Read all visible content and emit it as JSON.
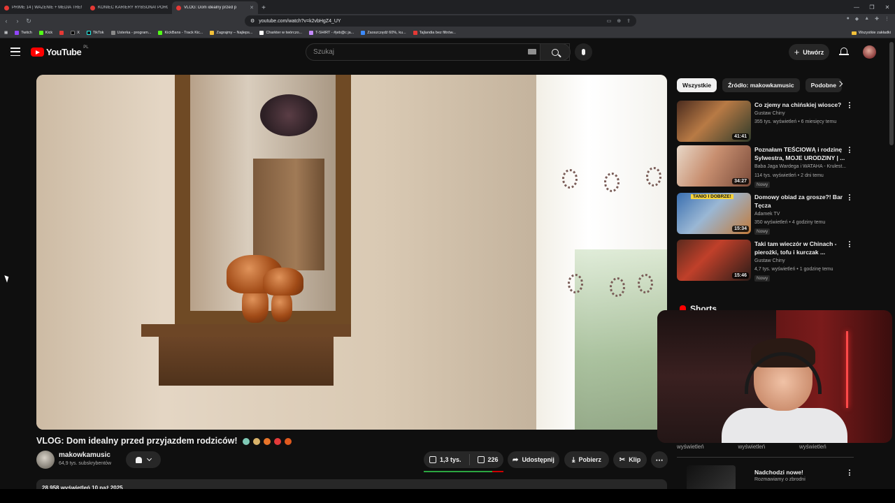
{
  "browser": {
    "tabs": [
      {
        "title": "PRIME 14 | WAŻENIE + MEDIA TRENI",
        "active": false
      },
      {
        "title": "KONIEC KARIERY RYBSONA! PORÓŻ",
        "active": false
      },
      {
        "title": "VLOG: Dom idealny przed p",
        "active": true
      }
    ],
    "url": "youtube.com/watch?v=k2vbHgZ4_UY",
    "bookmarks": [
      "Twitch",
      "Kick",
      "X",
      "TikTok",
      "Usterka - program...",
      "KickBans - Track Kic...",
      "Zagrajmy – Najleps...",
      "Charkter w twórczo...",
      "T-SHIRT - #jeb@c ja...",
      "Zaoszczędź 60%, ku...",
      "Tajlandia bez filtrów..."
    ],
    "bookmarks_folder": "Wszystkie zakładki"
  },
  "yt_header": {
    "logo_text": "YouTube",
    "country": "PL",
    "search_placeholder": "Szukaj",
    "create_label": "Utwórz"
  },
  "video": {
    "title": "VLOG: Dom idealny przed przyjazdem rodziców!",
    "channel": "makowkamusic",
    "subscribers": "64,9 tys. subskrybentów",
    "likes": "1,3 tys.",
    "dislikes": "226",
    "share_label": "Udostępnij",
    "download_label": "Pobierz",
    "clip_label": "Klip",
    "like_ratio": 0.86,
    "description_header": "28 958 wyświetleń  10 paź 2025"
  },
  "sidebar": {
    "chips": [
      "Wszystkie",
      "Źródło: makowkamusic",
      "Podobne"
    ],
    "recommendations": [
      {
        "title": "Co zjemy na chińskiej wiosce?",
        "channel": "Gustaw Chiny",
        "meta": "355 tys. wyświetleń • 6 miesięcy temu",
        "duration": "41:41",
        "badge": ""
      },
      {
        "title": "Poznałam TEŚCIOWĄ i rodzinę Sylwestra, MOJE URODZINY | ...",
        "channel": "Baba Jaga Wardega i WATAHA - Krulest...",
        "meta": "114 tys. wyświetleń • 2 dni temu",
        "duration": "34:27",
        "badge": "Nowy"
      },
      {
        "title": "Domowy obiad za grosze?! Bar Tęcza",
        "channel": "Adamek TV",
        "meta": "350 wyświetleń • 4 godziny temu",
        "duration": "15:34",
        "badge": "Nowy",
        "thumb_text": "TANIO I DOBRZE!"
      },
      {
        "title": "Taki tam wieczór w Chinach - pierożki, tofu i kurczak ...",
        "channel": "Gustaw Chiny",
        "meta": "4,7 tys. wyświetleń • 1 godzinę temu",
        "duration": "15:46",
        "badge": "Nowy"
      }
    ],
    "shorts_heading": "Shorts",
    "short_view_labels": [
      "wyświetleń",
      "wyświetleń",
      "wyświetleń"
    ],
    "upcoming": {
      "title": "Nadchodzi nowe!",
      "channel": "Rozmawiamy o zbrodni"
    }
  }
}
